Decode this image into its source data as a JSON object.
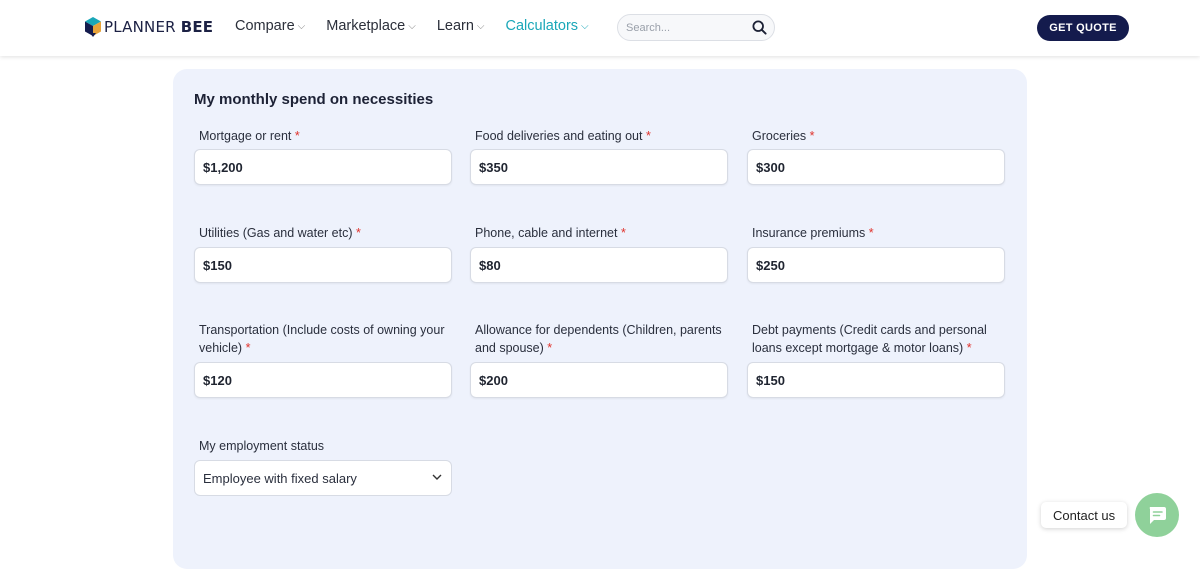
{
  "brand": {
    "logo_main": "PLANNER",
    "logo_bold": "BEE",
    "colors": {
      "navy": "#141b4d",
      "teal": "#1aa7b8",
      "card_bg": "#eef2fc",
      "required": "#e0322b",
      "chat_green": "#8fd19a"
    }
  },
  "nav": {
    "items": [
      {
        "label": "Compare",
        "active": false
      },
      {
        "label": "Marketplace",
        "active": false
      },
      {
        "label": "Learn",
        "active": false
      },
      {
        "label": "Calculators",
        "active": true
      }
    ],
    "search_placeholder": "Search...",
    "quote_label": "GET QUOTE"
  },
  "form": {
    "title": "My monthly spend on necessities",
    "required_mark": "*",
    "fields": [
      {
        "label": "Mortgage or rent",
        "value": "$1,200"
      },
      {
        "label": "Food deliveries and eating out",
        "value": "$350"
      },
      {
        "label": "Groceries",
        "value": "$300"
      },
      {
        "label": "Utilities (Gas and water etc)",
        "value": "$150"
      },
      {
        "label": "Phone, cable and internet",
        "value": "$80"
      },
      {
        "label": "Insurance premiums",
        "value": "$250"
      },
      {
        "label": "Transportation (Include costs of owning your vehicle)",
        "value": "$120"
      },
      {
        "label": "Allowance for dependents (Children, parents and spouse)",
        "value": "$200"
      },
      {
        "label": "Debt payments (Credit cards and personal loans except mortgage & motor loans)",
        "value": "$150"
      }
    ],
    "employment": {
      "label": "My employment status",
      "selected": "Employee with fixed salary"
    }
  },
  "contact": {
    "label": "Contact us"
  },
  "icons": [
    "logo-cube-icon",
    "chevron-down-icon",
    "search-icon",
    "chat-icon"
  ]
}
